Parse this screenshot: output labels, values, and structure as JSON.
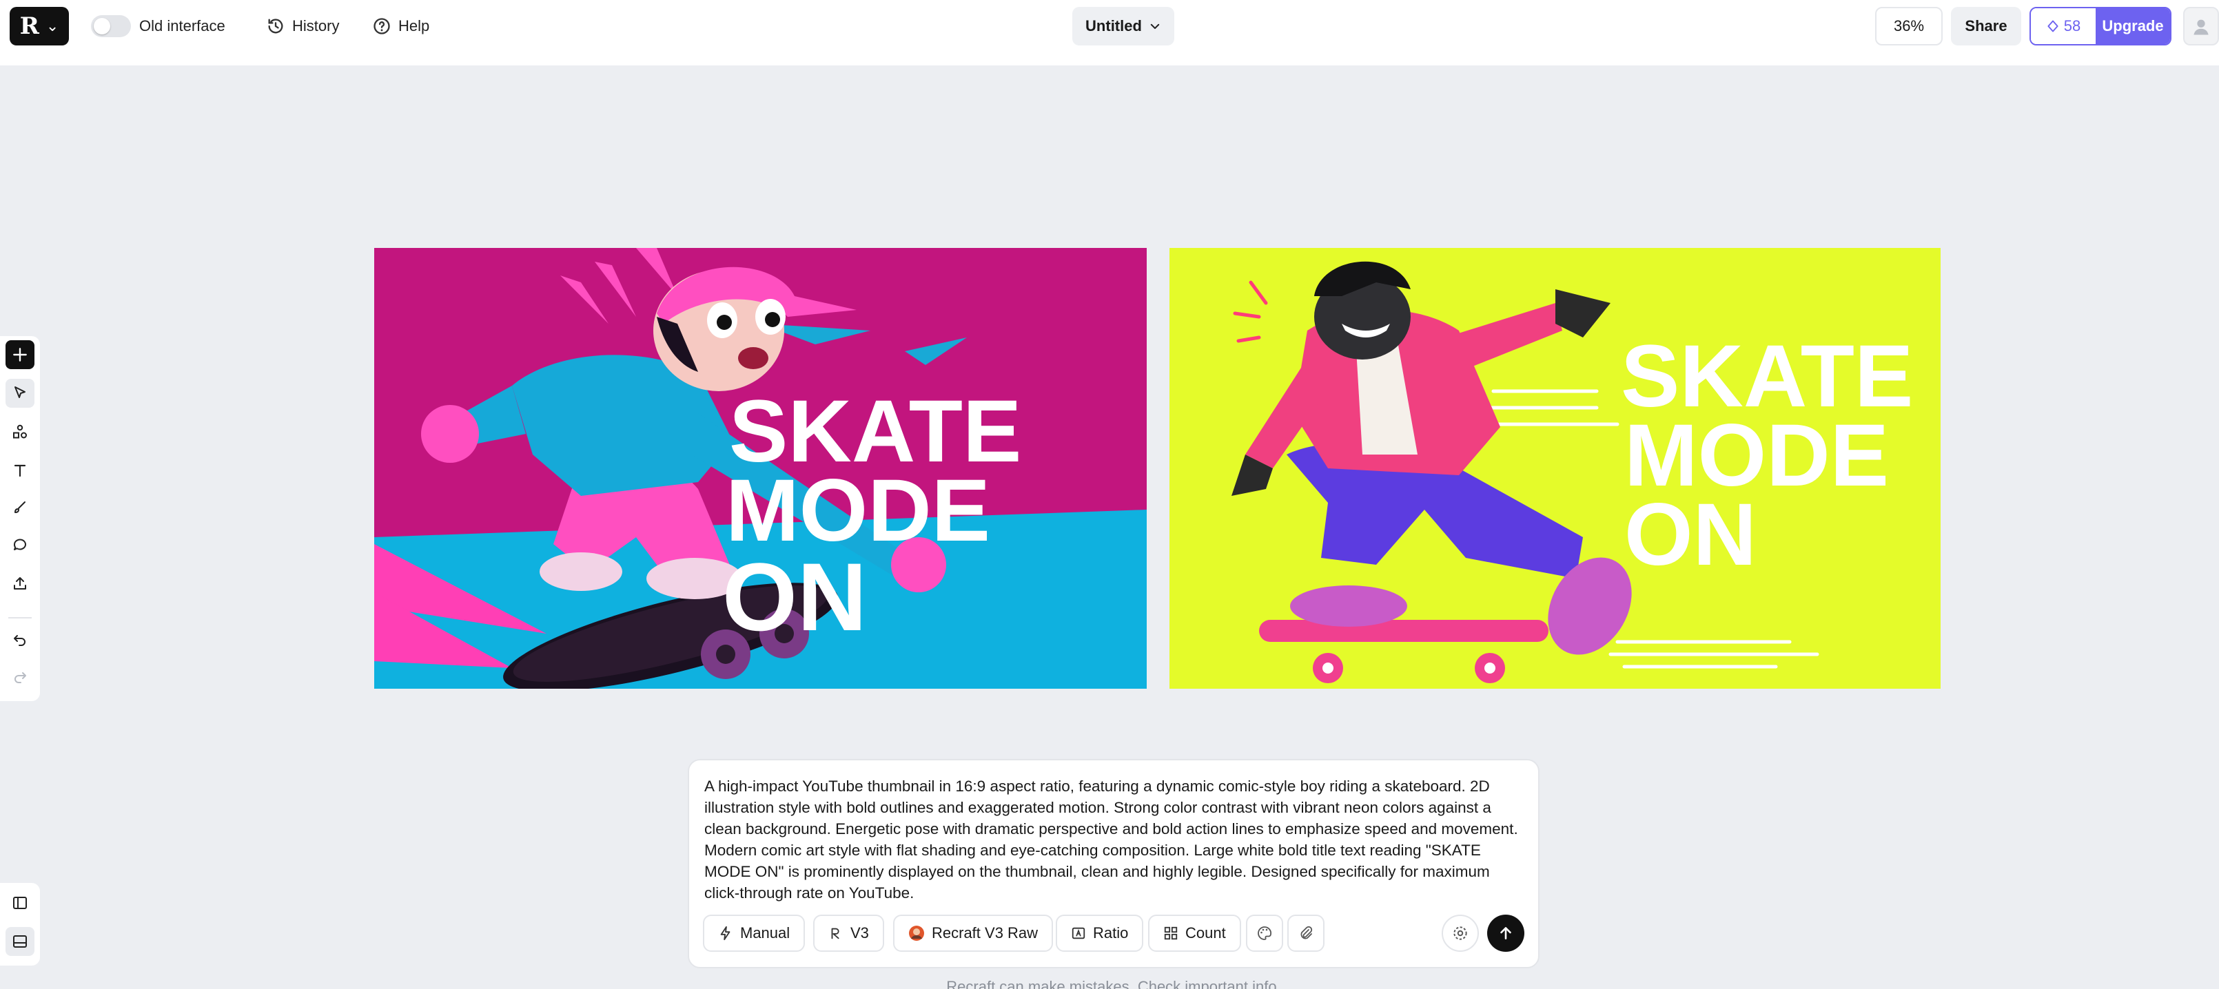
{
  "topbar": {
    "old_interface_label": "Old interface",
    "history_label": "History",
    "help_label": "Help",
    "document_title": "Untitled",
    "zoom_level": "36%",
    "share_label": "Share",
    "credits": "58",
    "upgrade_label": "Upgrade"
  },
  "artworks": [
    {
      "title_lines": [
        "SKATE",
        "MODE",
        "ON"
      ]
    },
    {
      "title_lines": [
        "SKATE",
        "MODE",
        "ON"
      ]
    }
  ],
  "prompt": {
    "text": "A high-impact YouTube thumbnail in 16:9 aspect ratio, featuring a dynamic comic-style boy riding a skateboard. 2D illustration style with bold outlines and exaggerated motion. Strong color contrast with vibrant neon colors against a clean background. Energetic pose with dramatic perspective and bold action lines to emphasize speed and movement. Modern comic art style with flat shading and eye-catching composition. Large white bold title text reading \"SKATE MODE ON\" is prominently displayed on the thumbnail, clean and highly legible. Designed specifically for maximum click-through rate on YouTube.",
    "chips": {
      "manual": "Manual",
      "version": "V3",
      "style": "Recraft V3 Raw",
      "ratio": "Ratio",
      "count": "Count"
    }
  },
  "disclaimer": "Recraft can make mistakes. Check important info.",
  "colors": {
    "accent": "#6d62f0",
    "art1_magenta": "#c2157e",
    "art1_cyan": "#0fb1df",
    "art2_lime": "#e4fb2a"
  }
}
